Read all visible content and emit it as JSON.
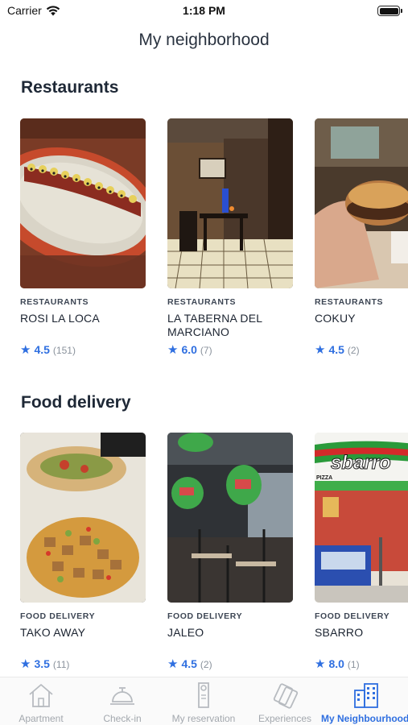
{
  "status_bar": {
    "carrier": "Carrier",
    "time": "1:18 PM"
  },
  "header": {
    "title": "My neighborhood"
  },
  "sections": [
    {
      "title": "Restaurants",
      "cards": [
        {
          "category": "RESTAURANTS",
          "name": "ROSI LA LOCA",
          "score": "4.5",
          "count": "(151)"
        },
        {
          "category": "RESTAURANTS",
          "name": "LA TABERNA DEL MARCIANO",
          "score": "6.0",
          "count": "(7)"
        },
        {
          "category": "RESTAURANTS",
          "name": "COKUY",
          "score": "4.5",
          "count": "(2)"
        }
      ]
    },
    {
      "title": "Food delivery",
      "cards": [
        {
          "category": "FOOD DELIVERY",
          "name": "TAKO AWAY",
          "score": "3.5",
          "count": "(11)"
        },
        {
          "category": "FOOD DELIVERY",
          "name": "JALEO",
          "score": "4.5",
          "count": "(2)"
        },
        {
          "category": "FOOD DELIVERY",
          "name": "SBARRO",
          "score": "8.0",
          "count": "(1)"
        }
      ]
    }
  ],
  "photo_text": {
    "sbarro_sign": "sbarro",
    "pizza_sign": "PIZZA"
  },
  "tab_bar": {
    "tabs": [
      {
        "label": "Apartment",
        "icon": "house-icon"
      },
      {
        "label": "Check-in",
        "icon": "service-bell-icon"
      },
      {
        "label": "My reservation",
        "icon": "door-hanger-icon"
      },
      {
        "label": "Experiences",
        "icon": "tickets-icon"
      },
      {
        "label": "My Neighbourhood",
        "icon": "buildings-icon",
        "active": true
      }
    ]
  },
  "colors": {
    "accent": "#2f6fe0",
    "inactive_tab": "#a3a8ae",
    "text": "#1c2431"
  }
}
